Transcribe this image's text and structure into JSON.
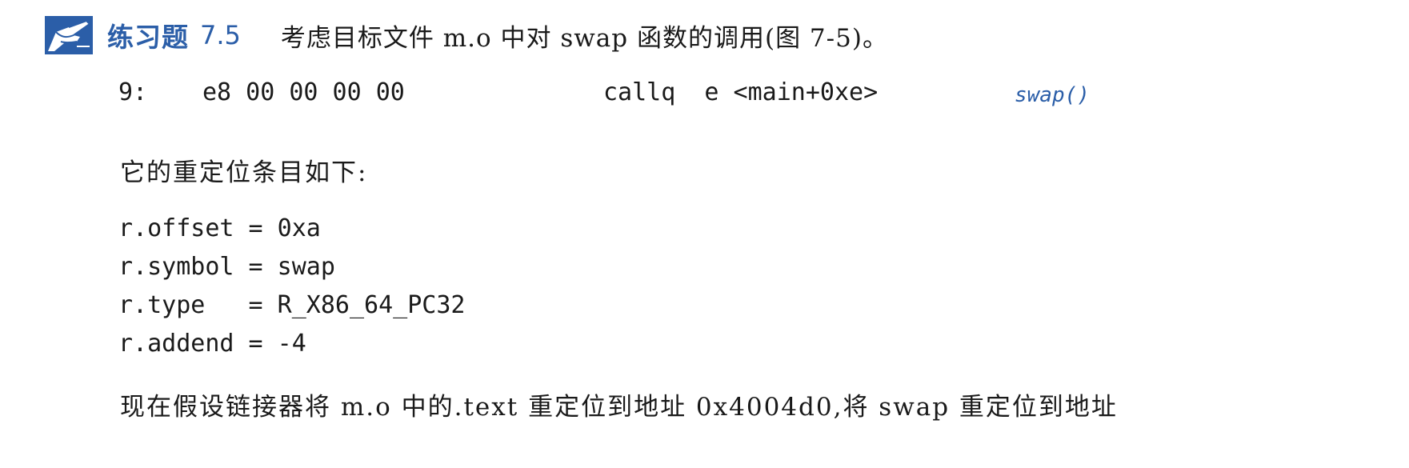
{
  "exercise": {
    "icon": "pencil-hand-icon",
    "label": "练习题",
    "number": "7.5",
    "prompt": "考虑目标文件 m.o 中对 swap 函数的调用(图 7-5)。"
  },
  "disassembly": {
    "address": "9:",
    "bytes": "e8 00 00 00 00",
    "instruction": "callq  e <main+0xe>",
    "comment": "swap()"
  },
  "intro_text": "它的重定位条目如下:",
  "relocation_entry": [
    "r.offset = 0xa",
    "r.symbol = swap",
    "r.type   = R_X86_64_PC32",
    "r.addend = -4"
  ],
  "continuation_text": "现在假设链接器将 m.o 中的.text 重定位到地址 0x4004d0,将 swap 重定位到地址",
  "colors": {
    "accent": "#2b5ea8",
    "text": "#1a1a1a",
    "background": "#ffffff"
  }
}
